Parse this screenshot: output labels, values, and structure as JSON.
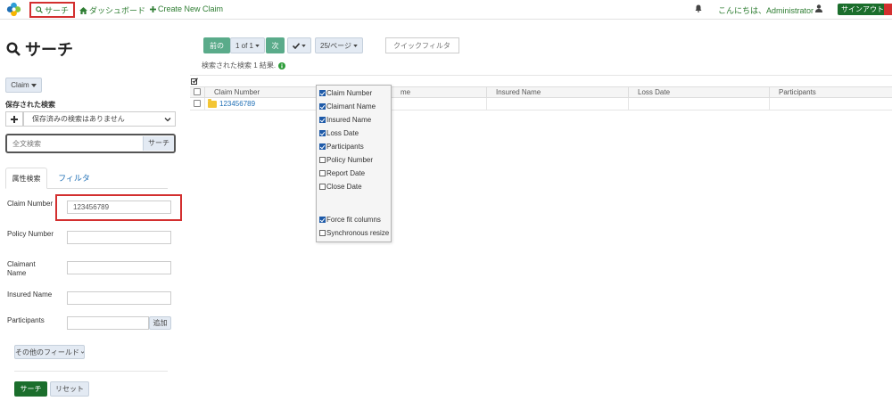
{
  "topnav": {
    "search": "サーチ",
    "dashboard": "ダッシュボード",
    "create_claim": "Create New Claim",
    "greeting": "こんにちは、Administrator",
    "signout": "サインアウト"
  },
  "sidebar": {
    "title": "サーチ",
    "entity_dropdown": "Claim",
    "saved_search_label": "保存された検索",
    "saved_search_placeholder": "保存済みの検索はありません",
    "fulltext_placeholder": "全文検索",
    "fulltext_button": "サーチ",
    "tabs": [
      {
        "label": "属性検索",
        "active": true
      },
      {
        "label": "フィルタ",
        "active": false
      }
    ],
    "fields": [
      {
        "label": "Claim Number",
        "value": "123456789"
      },
      {
        "label": "Policy Number",
        "value": ""
      },
      {
        "label": "Claimant Name",
        "value": ""
      },
      {
        "label": "Insured Name",
        "value": ""
      },
      {
        "label": "Participants",
        "value": ""
      }
    ],
    "add_button": "追加",
    "more_fields_button": "その他のフィールド",
    "search_button": "サーチ",
    "reset_button": "リセット"
  },
  "toolbar": {
    "prev": "前の",
    "page": "1 of 1",
    "next": "次",
    "per_page": "25/ページ",
    "quick_filter_placeholder": "クイックフィルタ",
    "results_text": "検索された検索 1 結果."
  },
  "grid": {
    "columns": [
      "Claim Number",
      "me",
      "Insured Name",
      "Loss Date",
      "Participants"
    ],
    "rows": [
      {
        "claim_number": "123456789"
      }
    ]
  },
  "column_chooser": {
    "options": [
      {
        "label": "Claim Number",
        "checked": true
      },
      {
        "label": "Claimant Name",
        "checked": true
      },
      {
        "label": "Insured Name",
        "checked": true
      },
      {
        "label": "Loss Date",
        "checked": true
      },
      {
        "label": "Participants",
        "checked": true
      },
      {
        "label": "Policy Number",
        "checked": false
      },
      {
        "label": "Report Date",
        "checked": false
      },
      {
        "label": "Close Date",
        "checked": false
      },
      {
        "label": "Force fit columns",
        "checked": true
      },
      {
        "label": "Synchronous resize",
        "checked": false
      }
    ]
  },
  "colors": {
    "accent_green": "#2e7d32",
    "dark_green": "#1b6e2c",
    "teal_button": "#5aab8a",
    "highlight_red": "#d32f2f",
    "link_blue": "#1f6fb5"
  }
}
